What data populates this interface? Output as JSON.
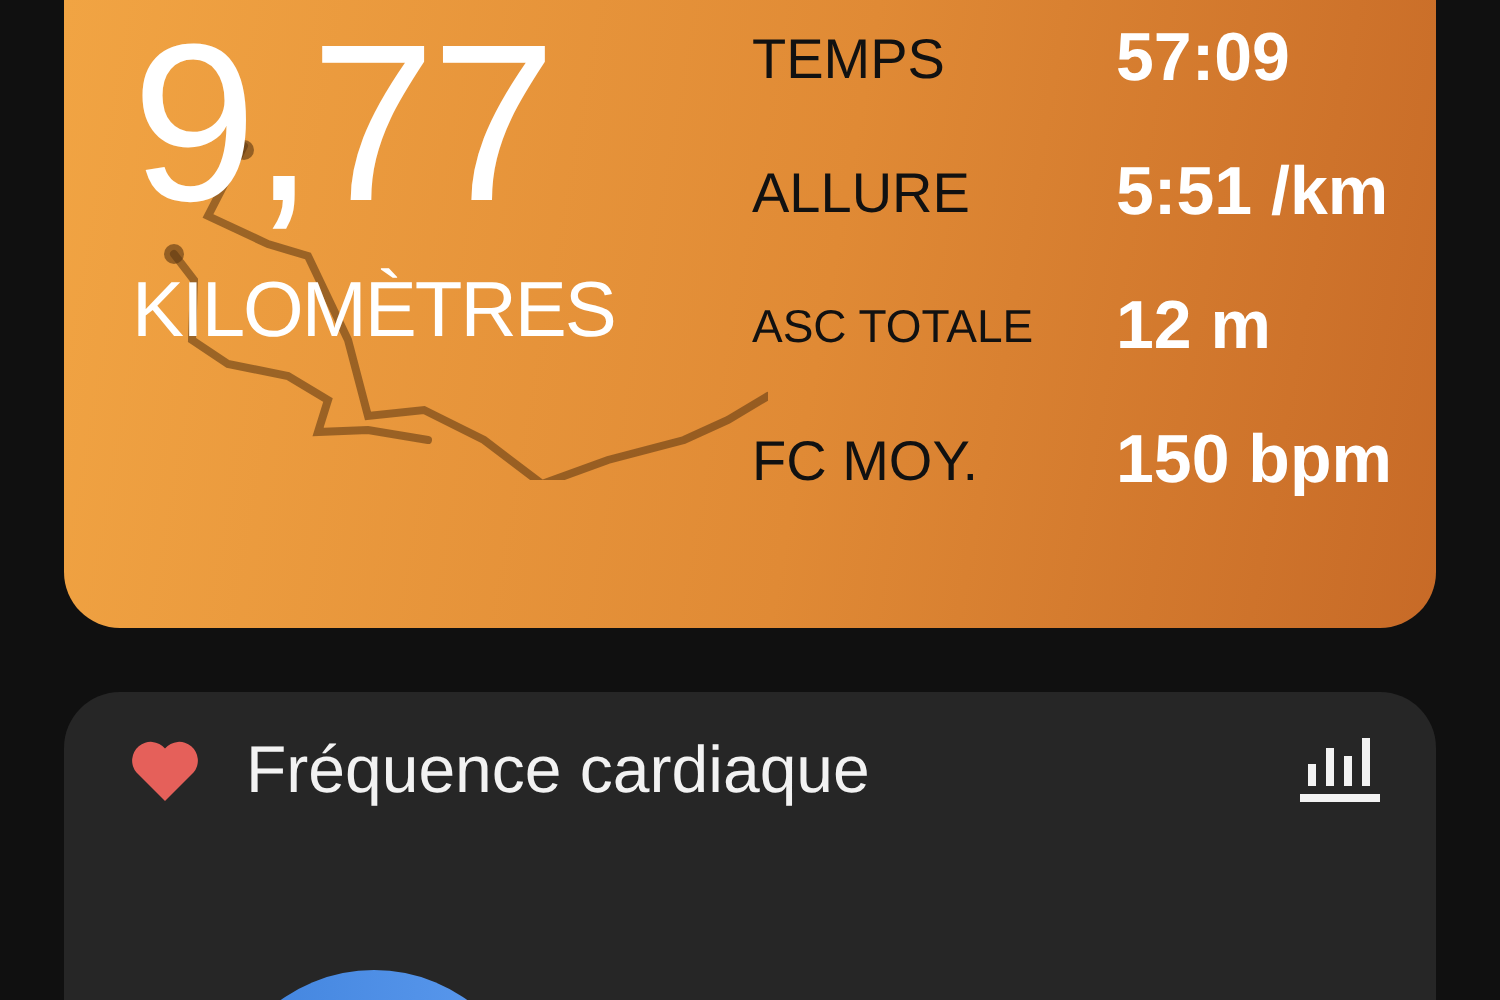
{
  "summary": {
    "distance": "9,77",
    "unit": "KILOMÈTRES",
    "stats": [
      {
        "label": "TEMPS",
        "value": "57:09"
      },
      {
        "label": "ALLURE",
        "value": "5:51 /km"
      },
      {
        "label": "ASC TOTALE",
        "value": "12 m",
        "compact": true
      },
      {
        "label": "FC MOY.",
        "value": "150 bpm"
      }
    ]
  },
  "heart_rate": {
    "title": "Fréquence cardiaque"
  }
}
